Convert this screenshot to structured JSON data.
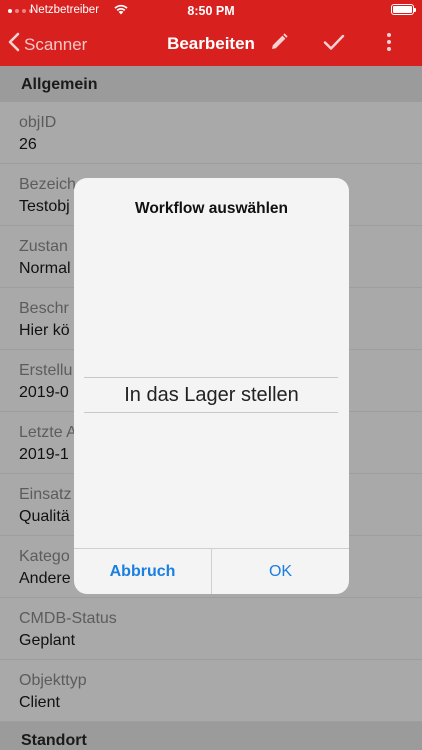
{
  "statusbar": {
    "carrier": "Netzbetreiber",
    "time": "8:50 PM"
  },
  "nav": {
    "back_label": "Scanner",
    "title": "Bearbeiten",
    "icons": [
      "pencil-icon",
      "checkmark-icon",
      "more-vertical-icon"
    ]
  },
  "sections": {
    "general": "Allgemein",
    "location": "Standort"
  },
  "rows": [
    {
      "label": "objID",
      "value": "26"
    },
    {
      "label": "Bezeich",
      "value": "Testobj"
    },
    {
      "label": "Zustan",
      "value": "Normal"
    },
    {
      "label": "Beschr",
      "value": "Hier kö"
    },
    {
      "label": "Erstellu",
      "value": "2019-0"
    },
    {
      "label": "Letzte A",
      "value": "2019-1"
    },
    {
      "label": "Einsatz",
      "value": "Qualitä"
    },
    {
      "label": "Katego",
      "value": "Andere"
    },
    {
      "label": "CMDB-Status",
      "value": "Geplant"
    },
    {
      "label": "Objekttyp",
      "value": "Client"
    }
  ],
  "dialog": {
    "title": "Workflow auswählen",
    "selected_option": "In das Lager stellen",
    "cancel_label": "Abbruch",
    "ok_label": "OK"
  },
  "colors": {
    "accent": "#d8201f",
    "dialog_button": "#1a7fe0"
  }
}
